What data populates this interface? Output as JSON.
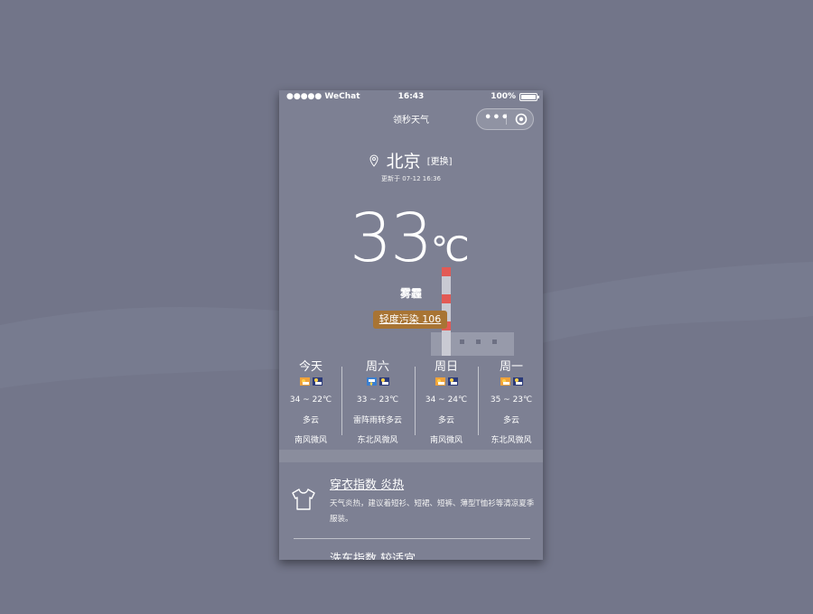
{
  "status_bar": {
    "carrier": "●●●●● WeChat",
    "time": "16:43",
    "battery": "100%"
  },
  "nav": {
    "title": "领秒天气",
    "more_label": "•••"
  },
  "location": {
    "city": "北京",
    "change_label": "[更换]",
    "updated": "更新于 07-12 16:36"
  },
  "current": {
    "temperature": "33",
    "unit": "℃",
    "condition": "雾霾",
    "aqi_label": "轻度污染 106"
  },
  "forecast": [
    {
      "day": "今天",
      "range": "34 ~ 22℃",
      "condition": "多云",
      "wind": "南风微风",
      "icons": [
        "sun-cloud-icon",
        "night-cloud-icon"
      ]
    },
    {
      "day": "周六",
      "range": "33 ~ 23℃",
      "condition": "雷阵雨转多云",
      "wind": "东北风微风",
      "icons": [
        "thunder-rain-icon",
        "night-cloud-icon"
      ]
    },
    {
      "day": "周日",
      "range": "34 ~ 24℃",
      "condition": "多云",
      "wind": "南风微风",
      "icons": [
        "sun-cloud-icon",
        "night-cloud-icon"
      ]
    },
    {
      "day": "周一",
      "range": "35 ~ 23℃",
      "condition": "多云",
      "wind": "东北风微风",
      "icons": [
        "sun-cloud-icon",
        "night-cloud-icon"
      ]
    }
  ],
  "indices": [
    {
      "title": "穿衣指数 炎热",
      "description": "天气炎热，建议着短衫、短裙、短裤、薄型T恤衫等清凉夏季服装。"
    },
    {
      "title": "洗车指数 较适宜"
    }
  ],
  "colors": {
    "background": "#727589",
    "phone_bg": "#7d8093",
    "aqi_badge": "#a87434",
    "chimney_red": "#e25a55"
  }
}
